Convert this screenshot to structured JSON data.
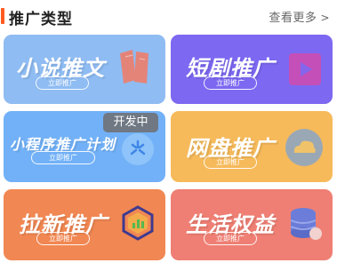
{
  "header": {
    "title": "推广类型",
    "more": "查看更多",
    "more_icon": "chevron-right-icon"
  },
  "cards": [
    {
      "title": "小说推文",
      "button": "立即推广",
      "color": "#8cbaf1",
      "icon": "book-icon"
    },
    {
      "title": "短剧推广",
      "button": "立即推广",
      "color": "#7b67f0",
      "icon": "play-icon"
    },
    {
      "title": "小程序推广计划",
      "button": "立即推广",
      "color": "#71b0f6",
      "icon": "miniprogram-icon",
      "badge": "开发中"
    },
    {
      "title": "网盘推广",
      "button": "立即推广",
      "color": "#f6b959",
      "icon": "cloud-icon"
    },
    {
      "title": "拉新推广",
      "button": "立即推广",
      "color": "#f18651",
      "icon": "hexagon-icon"
    },
    {
      "title": "生活权益",
      "button": "立即推广",
      "color": "#ef7e73",
      "icon": "coins-icon"
    }
  ]
}
